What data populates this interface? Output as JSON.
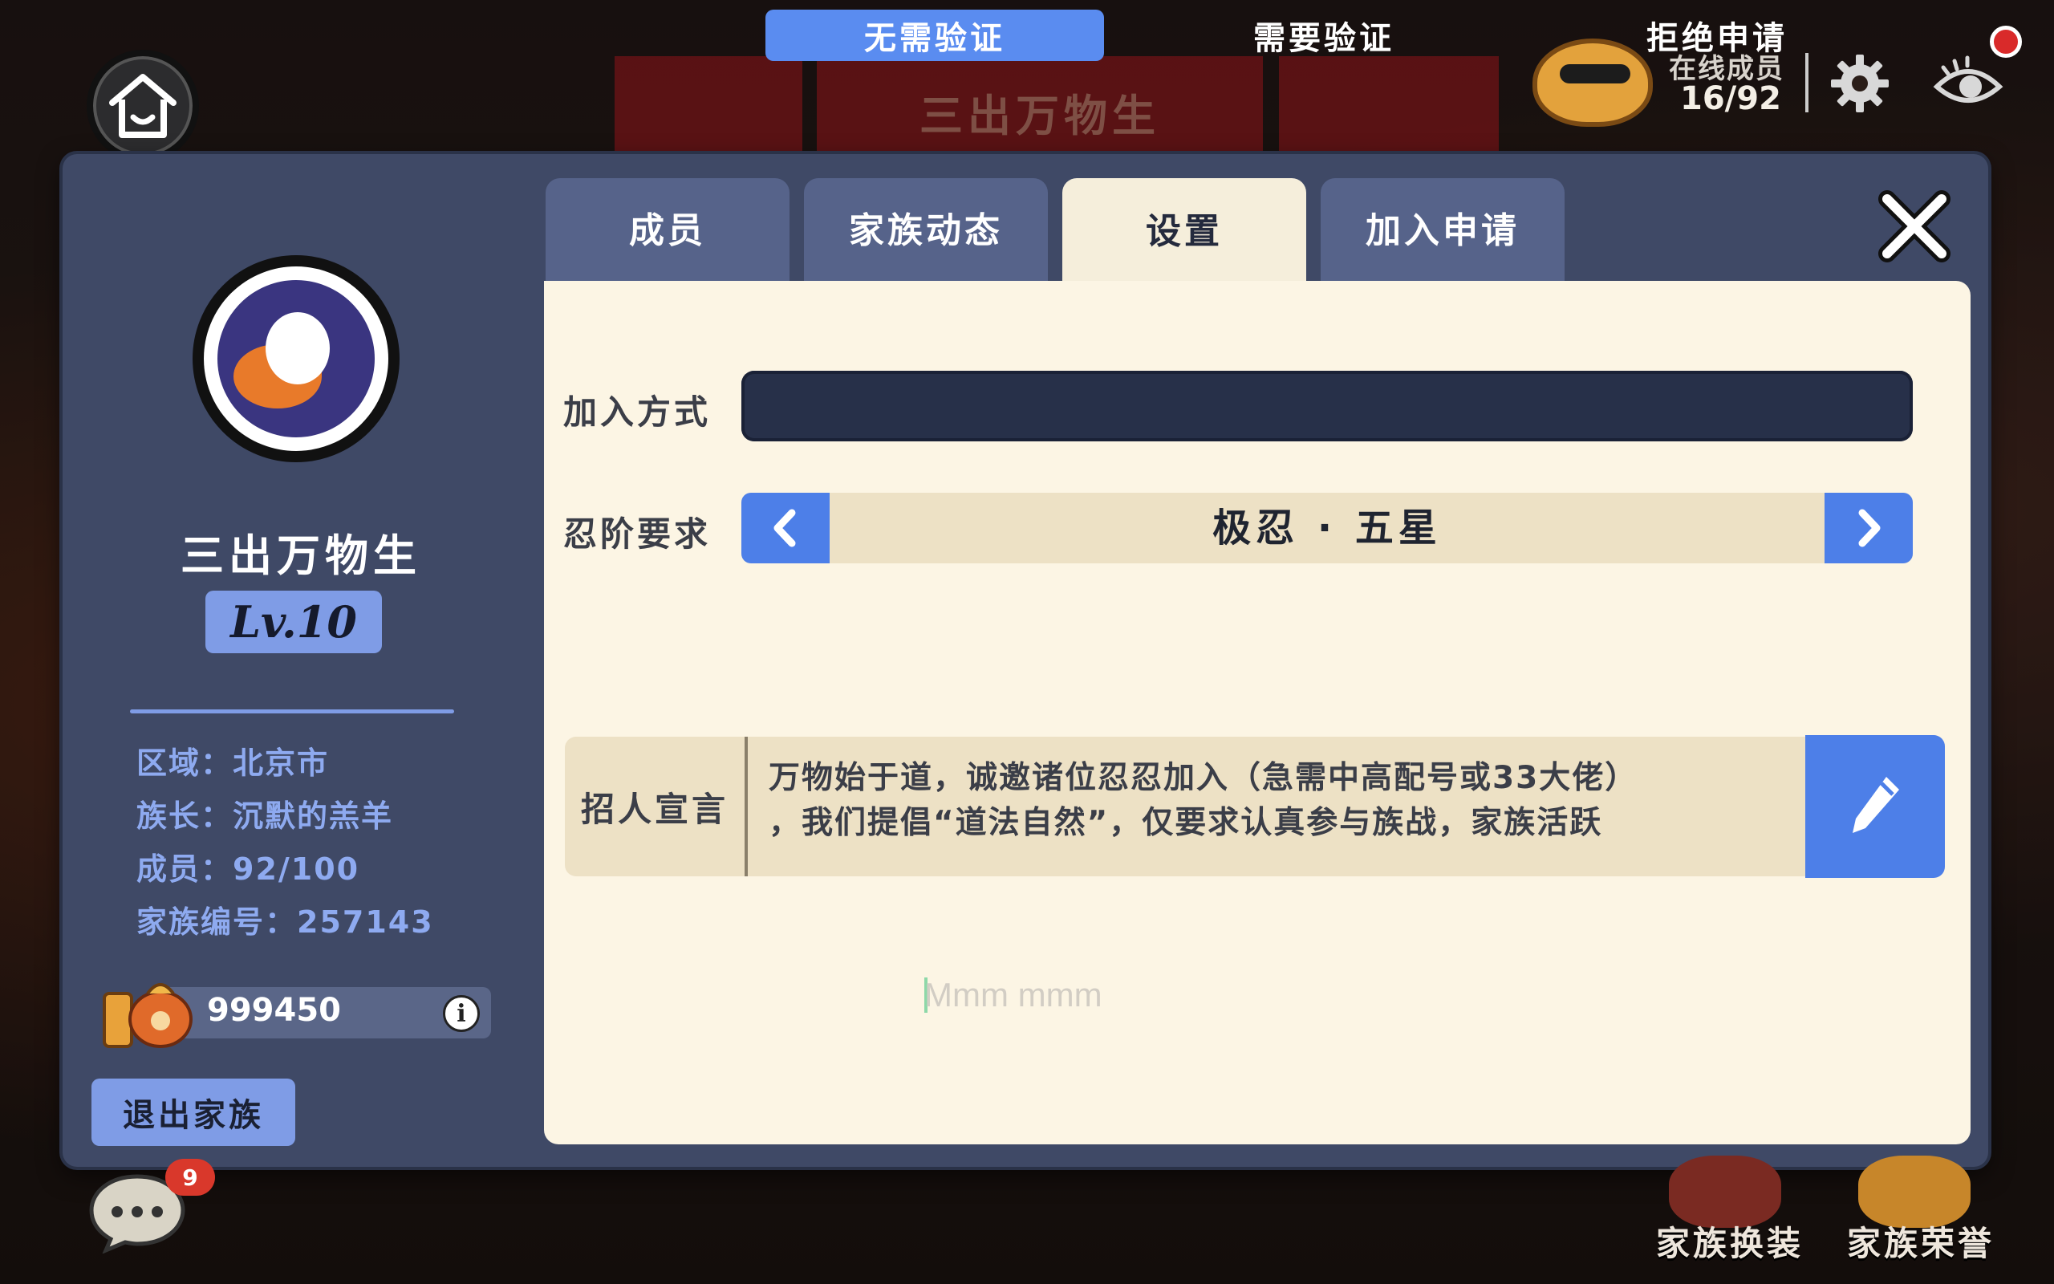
{
  "background": {
    "banner_title": "三出万物生"
  },
  "hud": {
    "online_label": "在线成员",
    "online_count": "16/92"
  },
  "sidebar": {
    "clan_name": "三出万物生",
    "level": "Lv.10",
    "region": "区域：北京市",
    "leader": "族长：沉默的羔羊",
    "members": "成员：92/100",
    "clan_id": "家族编号：257143",
    "coins": "999450",
    "quit_label": "退出家族"
  },
  "tabs": [
    {
      "label": "成员",
      "active": false
    },
    {
      "label": "家族动态",
      "active": false
    },
    {
      "label": "设置",
      "active": true
    },
    {
      "label": "加入申请",
      "active": false
    }
  ],
  "settings": {
    "join_label": "加入方式",
    "join_options": [
      "无需验证",
      "需要验证",
      "拒绝申请"
    ],
    "join_selected": "无需验证",
    "rank_label": "忍阶要求",
    "rank_value": "极忍 · 五星",
    "slogan_label": "招人宣言",
    "slogan_line1": "万物始于道，诚邀诸位忍忍加入（急需中高配号或33大佬）",
    "slogan_line2": "，我们提倡“道法自然”，仅要求认真参与族战，家族活跃",
    "input_overlay": "Mmm mmm"
  },
  "bottom": {
    "chat_badge": "9",
    "outfit_label": "家族换装",
    "honor_label": "家族荣誉"
  },
  "colors": {
    "panel": "#3f4966",
    "accent_blue": "#4d7fe8",
    "content_bg": "#fcf5e4",
    "tab_inactive": "#56638a",
    "level_badge": "#7f9ce6"
  },
  "icons": [
    "home-icon",
    "ninja-avatar-icon",
    "gear-icon",
    "eye-icon",
    "close-icon",
    "clan-emblem",
    "coin-bag-icon",
    "info-icon",
    "chevron-left-icon",
    "chevron-right-icon",
    "pencil-icon",
    "chat-icon"
  ]
}
